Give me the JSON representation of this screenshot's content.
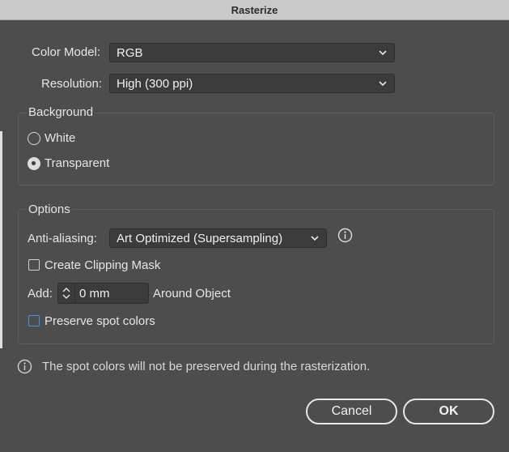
{
  "window": {
    "title": "Rasterize"
  },
  "color_model": {
    "label": "Color Model:",
    "value": "RGB"
  },
  "resolution": {
    "label": "Resolution:",
    "value": "High (300 ppi)"
  },
  "background": {
    "title": "Background",
    "options": [
      {
        "label": "White",
        "checked": false
      },
      {
        "label": "Transparent",
        "checked": true
      }
    ]
  },
  "options": {
    "title": "Options",
    "anti_aliasing": {
      "label": "Anti-aliasing:",
      "value": "Art Optimized (Supersampling)"
    },
    "create_clipping_mask": {
      "label": "Create Clipping Mask",
      "checked": false
    },
    "add": {
      "label": "Add:",
      "value": "0 mm",
      "suffix": "Around Object"
    },
    "preserve_spot_colors": {
      "label": "Preserve spot colors",
      "checked": false
    }
  },
  "info_message": "The spot colors will not be preserved during the rasterization.",
  "buttons": {
    "cancel": "Cancel",
    "ok": "OK"
  },
  "icons": {
    "chevron": "chevron-down-icon",
    "info": "info-icon",
    "stepper": "stepper-arrows-icon"
  }
}
